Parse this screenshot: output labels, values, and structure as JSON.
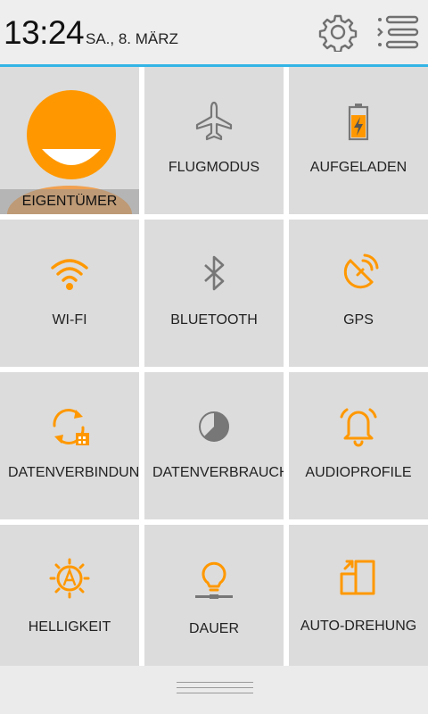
{
  "status": {
    "time": "13:24",
    "date": "SA., 8. MÄRZ"
  },
  "colors": {
    "accent": "#ff9800",
    "divider": "#33b5e5",
    "tile_bg": "#dcdcdc",
    "icon_gray": "#777777"
  },
  "tiles": [
    {
      "label": "EIGENTÜMER",
      "icon": "owner-avatar"
    },
    {
      "label": "FLUGMODUS",
      "icon": "airplane-icon"
    },
    {
      "label": "AUFGELADEN",
      "icon": "battery-charging-icon"
    },
    {
      "label": "WI-FI",
      "icon": "wifi-icon"
    },
    {
      "label": "BLUETOOTH",
      "icon": "bluetooth-icon"
    },
    {
      "label": "GPS",
      "icon": "gps-icon"
    },
    {
      "label": "DATENVERBINDUNG",
      "icon": "data-connection-icon"
    },
    {
      "label": "DATENVERBRAUCH",
      "icon": "data-usage-icon"
    },
    {
      "label": "AUDIOPROFILE",
      "icon": "audio-profile-bell-icon"
    },
    {
      "label": "HELLIGKEIT",
      "icon": "brightness-auto-icon"
    },
    {
      "label": "DAUER",
      "icon": "timeout-bulb-icon"
    },
    {
      "label": "AUTO-DREHUNG",
      "icon": "auto-rotate-icon"
    }
  ]
}
